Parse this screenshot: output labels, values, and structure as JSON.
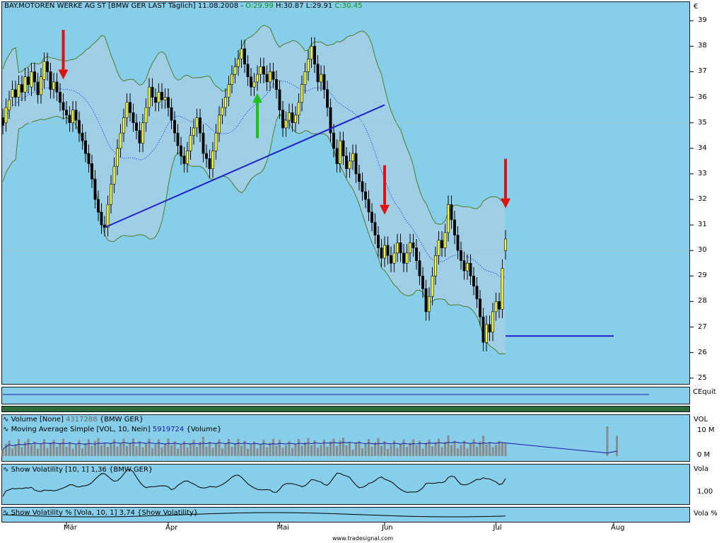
{
  "header": {
    "symbol": "BAY.MOTOREN WERKE AG ST [BMW GER LAST Täglich] 11.08.2008",
    "open": "O:29.99",
    "high": "H:30.87",
    "low": "L:29.91",
    "close": "C:30.45"
  },
  "currency": "€",
  "equity_label": "CEquit",
  "volume_panel": {
    "label1_prefix": "Volume [None]",
    "label1_value": "4317288",
    "label1_suffix": "{BMW GER}",
    "label2_prefix": "Moving Average Simple [VOL, 10, Nein]",
    "label2_value": "5919724",
    "label2_suffix": "{Volume}",
    "axis_title": "VOL",
    "ticks": [
      "10 M",
      "0 M"
    ]
  },
  "volatility_panel": {
    "label": "Show Volatility [10, 1] 1,36 {BMW GER}",
    "axis_title": "Vola",
    "tick": "1,00"
  },
  "volatility_pct_panel": {
    "label": "Show Volatility % [Vola, 10, 1] 3,74 {Show Volatility}",
    "axis_title": "Vola %"
  },
  "footer": "www.tradesignal.com",
  "colors": {
    "background": "#87ceeb",
    "band_fill": "#9fcfe6",
    "band_line": "#4f7a28",
    "bull_candle": "#ffff33",
    "bear_candle": "#000000",
    "trendline": "#1c24c8",
    "sell_arrow": "#e01010",
    "buy_arrow": "#20c020",
    "volume_bar": "#8a8a8a",
    "volume_ma": "#1a1aa0"
  },
  "chart_data": {
    "type": "candlestick",
    "title": "BAY.MOTOREN WERKE AG ST [BMW GER LAST Täglich] 11.08.2008",
    "ylim": [
      24.8,
      39.7
    ],
    "y_ticks": [
      25,
      26,
      27,
      28,
      29,
      30,
      31,
      32,
      33,
      34,
      35,
      36,
      37,
      38,
      39
    ],
    "months": [
      {
        "label": "Mär",
        "index": 20
      },
      {
        "label": "Apr",
        "index": 52
      },
      {
        "label": "Mai",
        "index": 87
      },
      {
        "label": "Jun",
        "index": 120
      },
      {
        "label": "Jul",
        "index": 155
      },
      {
        "label": "Aug",
        "index": 192
      }
    ],
    "closes": [
      34.9,
      35.6,
      35.9,
      36.3,
      36.0,
      36.5,
      36.2,
      36.8,
      36.5,
      37.0,
      36.6,
      36.1,
      36.8,
      37.4,
      37.0,
      36.3,
      36.6,
      36.2,
      35.8,
      35.5,
      35.3,
      35.0,
      35.5,
      35.1,
      34.6,
      34.3,
      33.8,
      33.4,
      32.8,
      32.0,
      31.5,
      31.0,
      30.9,
      31.8,
      32.6,
      33.3,
      34.0,
      34.6,
      35.2,
      35.8,
      35.4,
      35.0,
      34.7,
      34.2,
      35.0,
      35.6,
      36.4,
      36.0,
      35.8,
      36.2,
      35.9,
      36.0,
      35.6,
      35.1,
      34.6,
      34.1,
      33.7,
      33.4,
      33.9,
      34.5,
      34.8,
      35.2,
      34.6,
      33.8,
      33.6,
      33.2,
      33.9,
      34.6,
      35.3,
      35.6,
      36.0,
      36.5,
      36.9,
      37.2,
      37.5,
      37.9,
      37.3,
      36.8,
      36.4,
      36.6,
      36.9,
      37.2,
      36.9,
      36.6,
      37.0,
      36.7,
      36.3,
      35.5,
      34.8,
      35.1,
      35.4,
      35.0,
      35.3,
      35.8,
      36.5,
      37.0,
      37.5,
      38.0,
      37.3,
      36.6,
      36.9,
      36.3,
      35.6,
      34.6,
      34.0,
      33.4,
      34.3,
      33.7,
      33.2,
      33.5,
      33.8,
      33.0,
      32.7,
      32.3,
      32.0,
      31.5,
      31.1,
      30.6,
      30.1,
      29.7,
      30.2,
      29.8,
      29.5,
      29.9,
      30.3,
      29.9,
      29.5,
      29.9,
      30.3,
      30.1,
      29.6,
      29.0,
      28.5,
      27.6,
      28.2,
      29.0,
      29.8,
      30.4,
      30.1,
      30.7,
      31.8,
      31.2,
      30.6,
      30.0,
      29.6,
      29.2,
      29.5,
      29.0,
      28.6,
      28.1,
      27.4,
      26.4,
      27.1,
      26.8,
      27.6,
      28.0,
      27.7,
      29.3,
      30.45
    ],
    "opens": [
      35.2,
      35.0,
      35.5,
      36.0,
      36.3,
      36.0,
      36.5,
      36.2,
      36.8,
      36.4,
      37.0,
      36.6,
      36.1,
      36.7,
      37.4,
      37.0,
      36.3,
      36.6,
      36.2,
      35.8,
      35.5,
      35.3,
      35.0,
      35.5,
      35.1,
      34.6,
      34.3,
      33.8,
      33.4,
      32.8,
      32.0,
      31.5,
      31.0,
      30.9,
      31.8,
      32.6,
      33.3,
      34.0,
      34.6,
      35.2,
      35.8,
      35.4,
      35.0,
      34.7,
      34.2,
      35.0,
      35.6,
      36.4,
      36.0,
      35.8,
      36.2,
      35.9,
      36.0,
      35.6,
      35.1,
      34.6,
      34.1,
      33.7,
      33.4,
      33.9,
      34.5,
      34.8,
      35.2,
      34.6,
      33.8,
      33.6,
      33.2,
      33.9,
      34.6,
      35.3,
      35.6,
      36.0,
      36.5,
      36.9,
      37.2,
      37.5,
      37.9,
      37.3,
      36.8,
      36.4,
      36.6,
      36.9,
      37.2,
      36.9,
      36.6,
      37.0,
      36.7,
      36.3,
      35.5,
      34.8,
      35.1,
      35.4,
      35.0,
      35.3,
      35.8,
      36.5,
      37.0,
      37.5,
      38.0,
      37.3,
      36.6,
      36.9,
      36.3,
      35.6,
      34.6,
      34.0,
      33.4,
      34.3,
      33.7,
      33.2,
      33.5,
      33.8,
      33.0,
      32.7,
      32.3,
      32.0,
      31.5,
      31.1,
      30.6,
      30.1,
      29.7,
      30.2,
      29.8,
      29.5,
      29.9,
      30.3,
      29.9,
      29.5,
      29.9,
      30.3,
      30.1,
      29.6,
      29.0,
      28.5,
      27.6,
      28.2,
      29.0,
      29.8,
      30.4,
      30.1,
      30.7,
      31.8,
      31.2,
      30.6,
      30.0,
      29.6,
      29.2,
      29.5,
      29.0,
      28.6,
      28.1,
      27.4,
      26.4,
      27.1,
      26.8,
      27.6,
      28.0,
      27.7,
      29.99
    ],
    "upper_band_start": 38.2,
    "lower_band_start": 33.8,
    "trendlines": [
      {
        "from": [
          32,
          30.9
        ],
        "to": [
          120,
          35.7
        ]
      },
      {
        "from": [
          158,
          26.65
        ],
        "to": [
          192,
          26.65
        ]
      }
    ],
    "sell_arrows": [
      19,
      120,
      158
    ],
    "buy_arrows": [
      80
    ]
  }
}
